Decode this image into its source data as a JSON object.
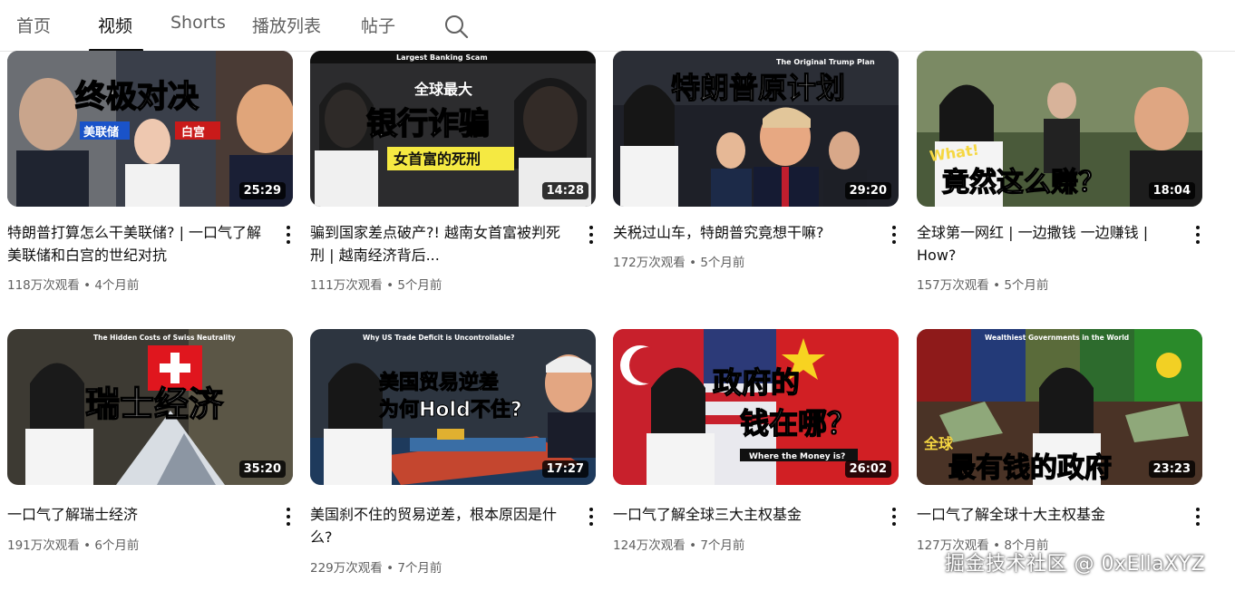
{
  "tabs": [
    {
      "label": "首页"
    },
    {
      "label": "视频"
    },
    {
      "label": "Shorts"
    },
    {
      "label": "播放列表"
    },
    {
      "label": "帖子"
    }
  ],
  "videos": [
    {
      "title": "特朗普打算怎么干美联储? | 一口气了解美联储和白宫的世纪对抗",
      "views": "118万次观看",
      "age": "4个月前",
      "duration": "25:29",
      "thumb_text": [
        "终极对决",
        "美联储",
        "白宫"
      ]
    },
    {
      "title": "骗到国家差点破产?! 越南女首富被判死刑 | 越南经济背后...",
      "views": "111万次观看",
      "age": "5个月前",
      "duration": "14:28",
      "thumb_text": [
        "Largest Banking Scam",
        "全球最大",
        "银行诈骗",
        "女首富的死刑"
      ]
    },
    {
      "title": "关税过山车，特朗普究竟想干嘛?",
      "views": "172万次观看",
      "age": "5个月前",
      "duration": "29:20",
      "thumb_text": [
        "The Original Trump Plan",
        "特朗普原计划"
      ]
    },
    {
      "title": "全球第一网红 | 一边撒钱 一边赚钱 | How?",
      "views": "157万次观看",
      "age": "5个月前",
      "duration": "18:04",
      "thumb_text": [
        "What!",
        "竟然这么赚？"
      ]
    },
    {
      "title": "一口气了解瑞士经济",
      "views": "191万次观看",
      "age": "6个月前",
      "duration": "35:20",
      "thumb_text": [
        "The Hidden Costs of Swiss Neutrality",
        "瑞士经济"
      ]
    },
    {
      "title": "美国刹不住的贸易逆差，根本原因是什么?",
      "views": "229万次观看",
      "age": "7个月前",
      "duration": "17:27",
      "thumb_text": [
        "Why US Trade Deficit is Uncontrollable?",
        "美国贸易逆差",
        "为何Hold不住?"
      ]
    },
    {
      "title": "一口气了解全球三大主权基金",
      "views": "124万次观看",
      "age": "7个月前",
      "duration": "26:02",
      "thumb_text": [
        "政府的",
        "钱在哪？",
        "Where the Money is?"
      ]
    },
    {
      "title": "一口气了解全球十大主权基金",
      "views": "127万次观看",
      "age": "8个月前",
      "duration": "23:23",
      "thumb_text": [
        "Wealthiest Governments in the World",
        "全球",
        "最有钱的政府"
      ]
    }
  ],
  "watermark": "掘金技术社区 @ 0xEllaXYZ"
}
